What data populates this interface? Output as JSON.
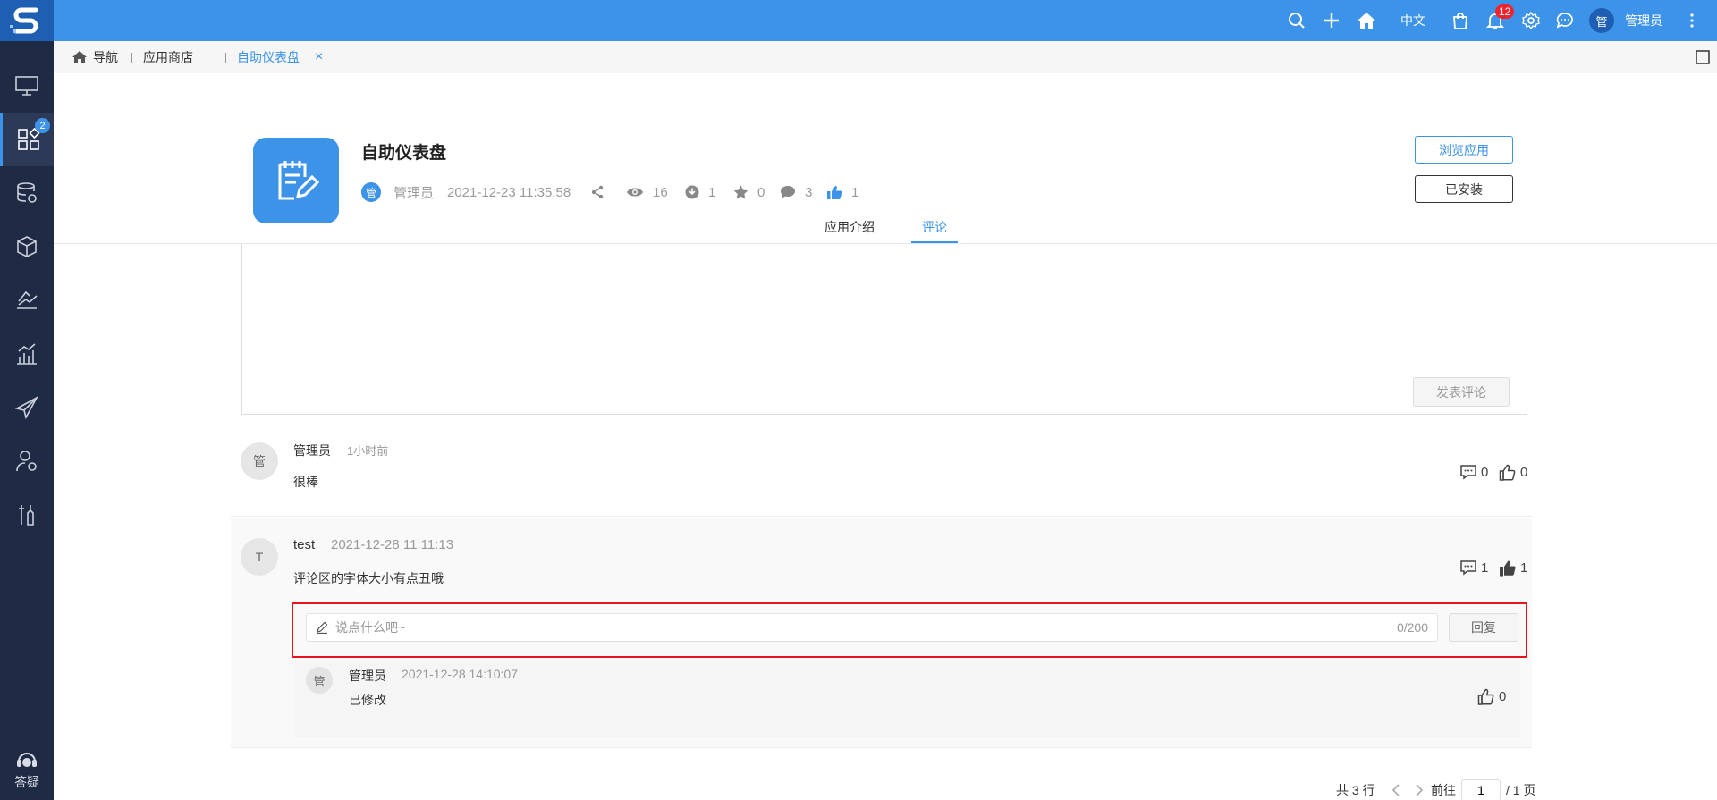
{
  "topbar": {
    "lang": "中文",
    "notif_count": "12",
    "user_avatar": "管",
    "user_name": "管理员"
  },
  "sidebar": {
    "apps_badge": "2",
    "help_label": "答疑"
  },
  "breadcrumb": {
    "nav": "导航",
    "store": "应用商店",
    "current": "自助仪表盘",
    "close": "×"
  },
  "app": {
    "title": "自助仪表盘",
    "author_avatar": "管",
    "author": "管理员",
    "date": "2021-12-23 11:35:58",
    "views": "16",
    "downloads": "1",
    "favorites": "0",
    "comments": "3",
    "likes": "1",
    "browse_label": "浏览应用",
    "installed_label": "已安装"
  },
  "tabs": {
    "intro": "应用介绍",
    "comments": "评论"
  },
  "editor": {
    "post_label": "发表评论"
  },
  "comments": [
    {
      "avatar": "管",
      "author": "管理员",
      "time": "1小时前",
      "text": "很棒",
      "replies": "0",
      "likes": "0"
    },
    {
      "avatar": "T",
      "author": "test",
      "time": "2021-12-28 11:11:13",
      "text": "评论区的字体大小有点丑哦",
      "replies": "1",
      "likes": "1"
    }
  ],
  "reply_form": {
    "placeholder": "说点什么吧~",
    "count": "0/200",
    "button": "回复"
  },
  "sub_reply": {
    "avatar": "管",
    "author": "管理员",
    "time": "2021-12-28 14:10:07",
    "text": "已修改",
    "likes": "0"
  },
  "pager": {
    "total": "共 3 行",
    "goto": "前往",
    "page": "1",
    "pages": "/ 1 页"
  },
  "colors": {
    "primary": "#3d93e8",
    "sidebar": "#1f2a44",
    "highlight": "#e8141c"
  }
}
